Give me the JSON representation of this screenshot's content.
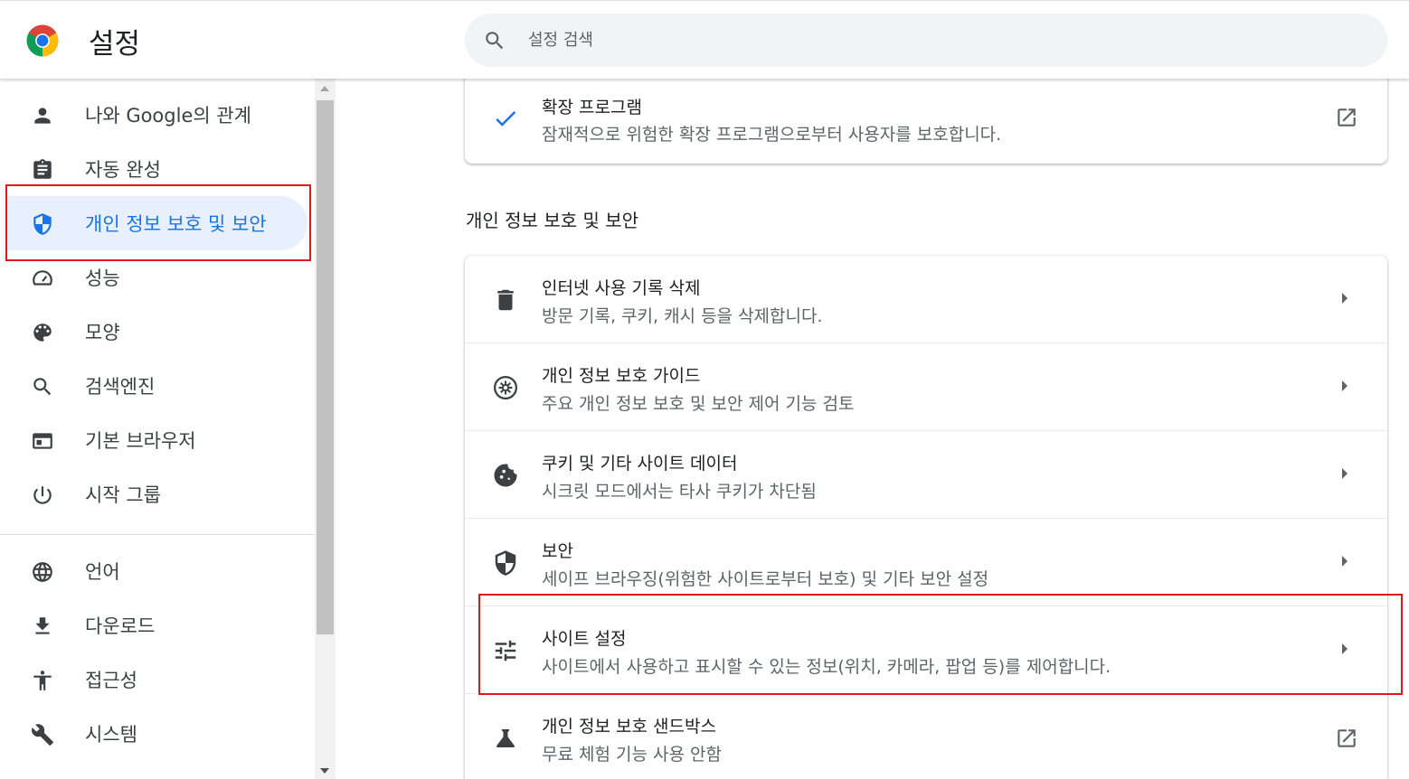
{
  "header": {
    "title": "설정",
    "search_placeholder": "설정 검색"
  },
  "sidebar": {
    "items": [
      {
        "label": "나와 Google의 관계",
        "icon": "person-icon"
      },
      {
        "label": "자동 완성",
        "icon": "clipboard-icon"
      },
      {
        "label": "개인 정보 보호 및 보안",
        "icon": "shield-icon",
        "active": true
      },
      {
        "label": "성능",
        "icon": "speedometer-icon"
      },
      {
        "label": "모양",
        "icon": "palette-icon"
      },
      {
        "label": "검색엔진",
        "icon": "search-icon"
      },
      {
        "label": "기본 브라우저",
        "icon": "browser-window-icon"
      },
      {
        "label": "시작 그룹",
        "icon": "power-icon"
      },
      {
        "label": "언어",
        "icon": "globe-icon"
      },
      {
        "label": "다운로드",
        "icon": "download-icon"
      },
      {
        "label": "접근성",
        "icon": "accessibility-icon"
      },
      {
        "label": "시스템",
        "icon": "wrench-icon"
      }
    ]
  },
  "extensions_card": {
    "title": "확장 프로그램",
    "subtitle": "잠재적으로 위험한 확장 프로그램으로부터 사용자를 보호합니다.",
    "icon": "checkmark-icon"
  },
  "privacy_section": {
    "title": "개인 정보 보호 및 보안",
    "rows": [
      {
        "title": "인터넷 사용 기록 삭제",
        "subtitle": "방문 기록, 쿠키, 캐시 등을 삭제합니다.",
        "icon": "trash-icon"
      },
      {
        "title": "개인 정보 보호 가이드",
        "subtitle": "주요 개인 정보 보호 및 보안 제어 기능 검토",
        "icon": "compass-icon"
      },
      {
        "title": "쿠키 및 기타 사이트 데이터",
        "subtitle": "시크릿 모드에서는 타사 쿠키가 차단됨",
        "icon": "cookie-icon"
      },
      {
        "title": "보안",
        "subtitle": "세이프 브라우징(위험한 사이트로부터 보호) 및 기타 보안 설정",
        "icon": "shield-icon"
      },
      {
        "title": "사이트 설정",
        "subtitle": "사이트에서 사용하고 표시할 수 있는 정보(위치, 카메라, 팝업 등)를 제어합니다.",
        "icon": "sliders-icon"
      },
      {
        "title": "개인 정보 보호 샌드박스",
        "subtitle": "무료 체험 기능 사용 안함",
        "icon": "flask-icon"
      }
    ]
  },
  "colors": {
    "accent": "#1a73e8",
    "active_bg": "#e8f0fe",
    "highlight_box": "#e3161c"
  }
}
